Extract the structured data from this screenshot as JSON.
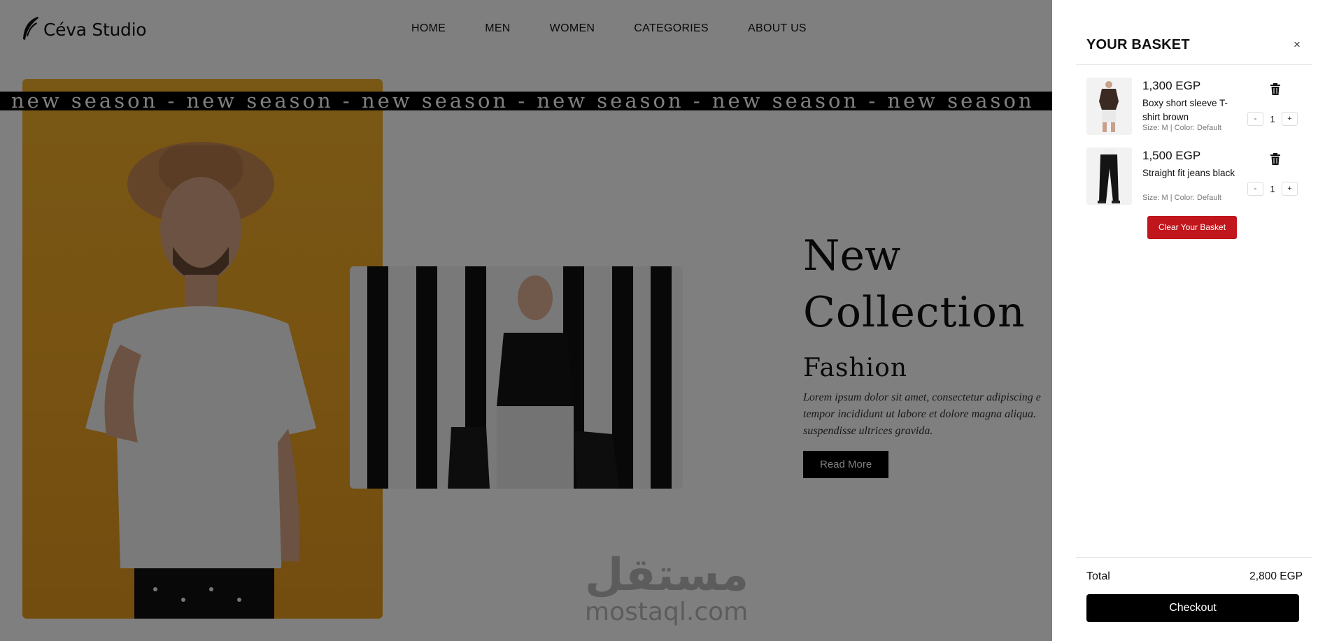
{
  "brand": {
    "name": "Céva Studio"
  },
  "nav": {
    "items": [
      "HOME",
      "MEN",
      "WOMEN",
      "CATEGORIES",
      "ABOUT US"
    ]
  },
  "ticker": {
    "text": "new season - new season - new season - new season - new season - new season"
  },
  "hero": {
    "title_line1": "New",
    "title_line2": "Collection",
    "subtitle": "Fashion",
    "body": "Lorem ipsum dolor sit amet, consectetur adipiscing elit, sed do eiusmod tempor incididunt ut labore et dolore magna aliqua. Quis ipsum suspendisse ultrices gravida.",
    "body_lines": [
      "Lorem ipsum dolor sit amet, consectetur adipiscing e",
      "tempor incididunt ut labore et dolore magna aliqua.",
      "suspendisse ultrices gravida."
    ],
    "cta": "Read More"
  },
  "watermark": {
    "arabic": "مستقل",
    "latin": "mostaql.com"
  },
  "basket": {
    "title": "YOUR BASKET",
    "close_symbol": "×",
    "items": [
      {
        "price": "1,300 EGP",
        "name": "Boxy short sleeve T-shirt brown",
        "meta": "Size: M | Color: Default",
        "qty": "1",
        "minus": "-",
        "plus": "+"
      },
      {
        "price": "1,500 EGP",
        "name": "Straight fit jeans black",
        "meta": "Size: M | Color: Default",
        "qty": "1",
        "minus": "-",
        "plus": "+"
      }
    ],
    "clear_label": "Clear Your Basket",
    "total_label": "Total",
    "total_value": "2,800 EGP",
    "checkout_label": "Checkout"
  },
  "colors": {
    "accent": "#c0161c",
    "overlay": "rgba(0,0,0,0.5)",
    "hero_yellow": "#f3b02b"
  }
}
